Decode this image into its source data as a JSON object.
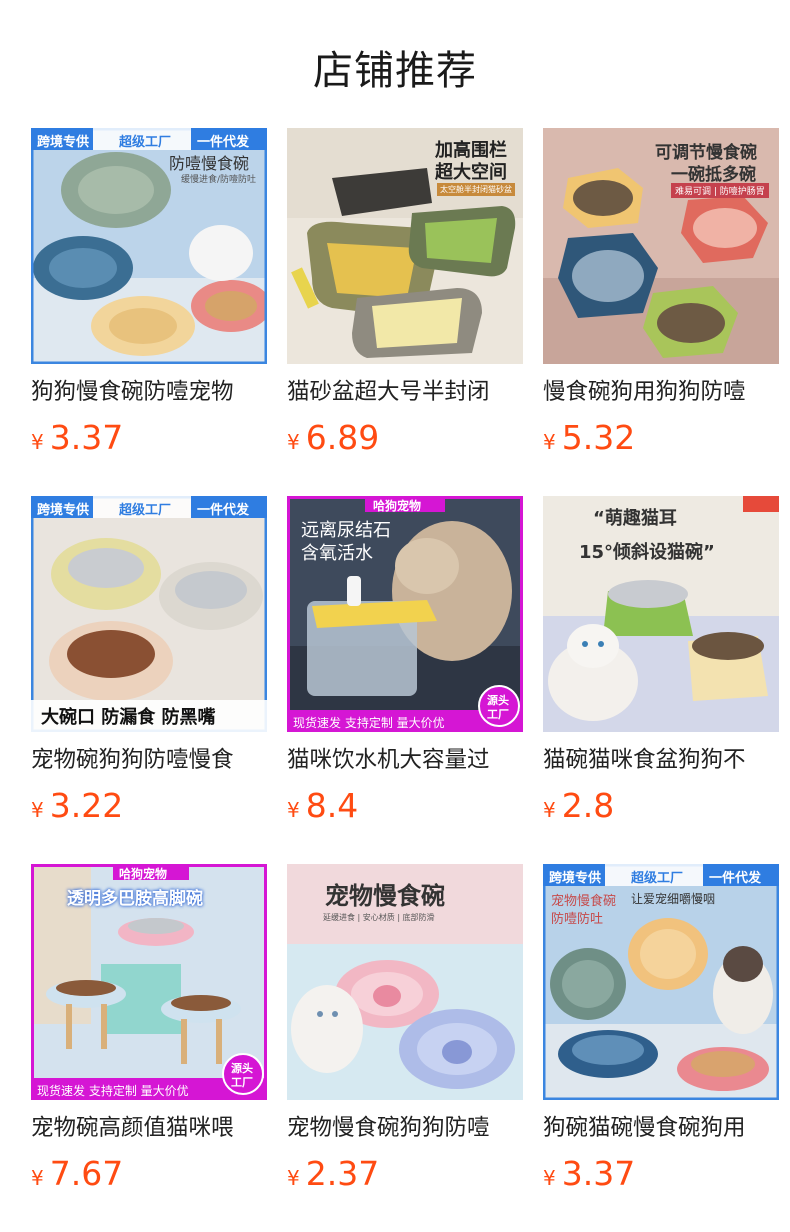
{
  "section_title": "店铺推荐",
  "currency": "¥",
  "products": [
    {
      "name": "狗狗慢食碗防噎宠物",
      "price": "3.37",
      "overlay": {
        "tag_left": "跨境专供",
        "tag_mid": "超级工厂",
        "tag_right": "一件代发",
        "headline": "防噎慢食碗",
        "sub": "缓慢进食/防噎防吐"
      }
    },
    {
      "name": "猫砂盆超大号半封闭",
      "price": "6.89",
      "overlay": {
        "headline": "加高围栏",
        "headline2": "超大空间",
        "sub": "太空舱半封闭猫砂盆"
      }
    },
    {
      "name": "慢食碗狗用狗狗防噎",
      "price": "5.32",
      "overlay": {
        "headline": "可调节慢食碗",
        "headline2": "一碗抵多碗",
        "sub": "难易可调 | 防噎护肠胃"
      }
    },
    {
      "name": "宠物碗狗狗防噎慢食",
      "price": "3.22",
      "overlay": {
        "tag_left": "跨境专供",
        "tag_mid": "超级工厂",
        "tag_right": "一件代发",
        "footer": "大碗口 防漏食 防黑嘴"
      }
    },
    {
      "name": "猫咪饮水机大容量过",
      "price": "8.4",
      "overlay": {
        "brand": "哈狗宠物",
        "headline": "远离尿结石",
        "headline2": "含氧活水",
        "footer": "现货速发 支持定制 量大价优",
        "badge_top": "源头",
        "badge_bottom": "工厂"
      }
    },
    {
      "name": "猫碗猫咪食盆狗狗不",
      "price": "2.8",
      "overlay": {
        "headline": "“萌趣猫耳",
        "headline2": "15°倾斜设猫碗”"
      }
    },
    {
      "name": "宠物碗高颜值猫咪喂",
      "price": "7.67",
      "overlay": {
        "brand": "哈狗宠物",
        "headline": "透明多巴胺高脚碗",
        "footer": "现货速发 支持定制 量大价优",
        "badge_top": "源头",
        "badge_bottom": "工厂"
      }
    },
    {
      "name": "宠物慢食碗狗狗防噎",
      "price": "2.37",
      "overlay": {
        "headline": "宠物慢食碗",
        "sub": "延缓进食 | 安心材质 | 底部防滑"
      }
    },
    {
      "name": "狗碗猫碗慢食碗狗用",
      "price": "3.37",
      "overlay": {
        "tag_left": "跨境专供",
        "tag_mid": "超级工厂",
        "tag_right": "一件代发",
        "headline": "宠物慢食碗",
        "headline2": "防噎防吐",
        "sub": "让爱宠细嚼慢咽"
      }
    }
  ]
}
